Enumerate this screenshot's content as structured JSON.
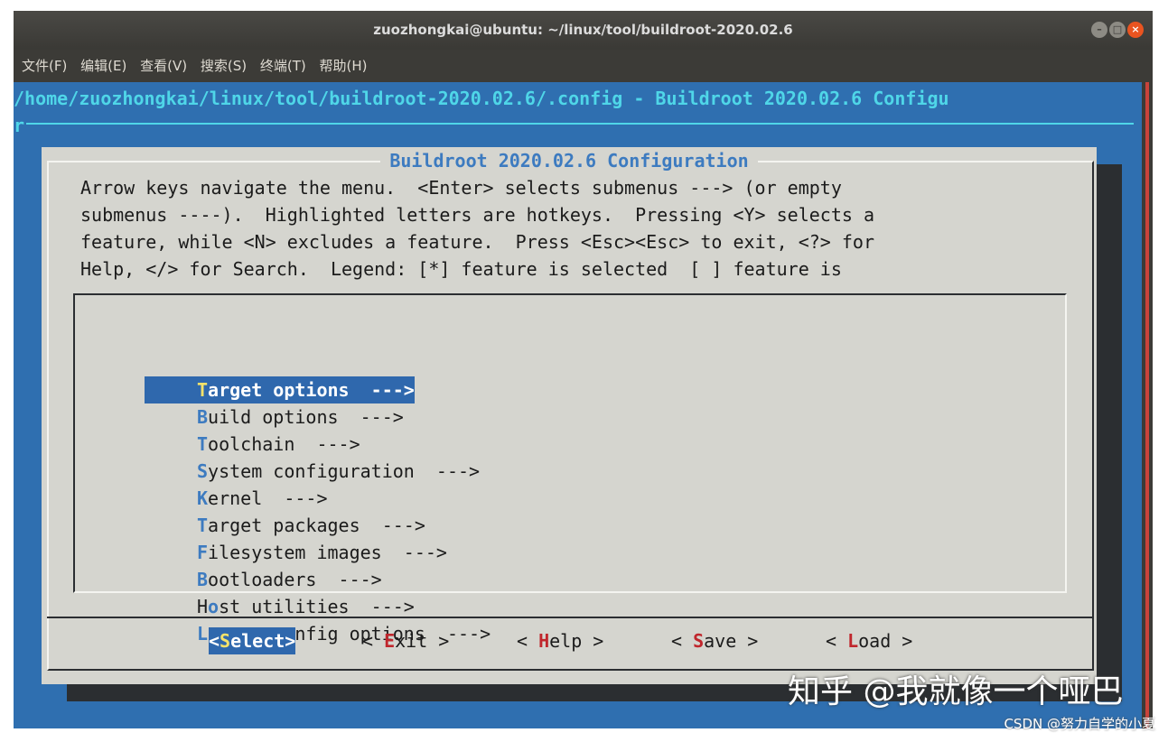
{
  "window": {
    "title": "zuozhongkai@ubuntu: ~/linux/tool/buildroot-2020.02.6",
    "controls": {
      "minimize": "–",
      "maximize": "□",
      "close": "×"
    }
  },
  "menubar": [
    "文件(F)",
    "编辑(E)",
    "查看(V)",
    "搜索(S)",
    "终端(T)",
    "帮助(H)"
  ],
  "terminal": {
    "path_line": "/home/zuozhongkai/linux/tool/buildroot-2020.02.6/.config - Buildroot 2020.02.6 Configu",
    "wrap_line": "r"
  },
  "dialog": {
    "title": "Buildroot 2020.02.6 Configuration",
    "help_lines": [
      "Arrow keys navigate the menu.  <Enter> selects submenus ---> (or empty",
      "submenus ----).  Highlighted letters are hotkeys.  Pressing <Y> selects a",
      "feature, while <N> excludes a feature.  Press <Esc><Esc> to exit, <?> for",
      "Help, </> for Search.  Legend: [*] feature is selected  [ ] feature is"
    ],
    "menu_items": [
      {
        "pre": "",
        "hot": "T",
        "rest": "arget options  --->",
        "selected": true
      },
      {
        "pre": "",
        "hot": "B",
        "rest": "uild options  --->",
        "selected": false
      },
      {
        "pre": "",
        "hot": "T",
        "rest": "oolchain  --->",
        "selected": false
      },
      {
        "pre": "",
        "hot": "S",
        "rest": "ystem configuration  --->",
        "selected": false
      },
      {
        "pre": "",
        "hot": "K",
        "rest": "ernel  --->",
        "selected": false
      },
      {
        "pre": "",
        "hot": "T",
        "rest": "arget packages  --->",
        "selected": false
      },
      {
        "pre": "",
        "hot": "F",
        "rest": "ilesystem images  --->",
        "selected": false
      },
      {
        "pre": "",
        "hot": "B",
        "rest": "ootloaders  --->",
        "selected": false
      },
      {
        "pre": "H",
        "hot": "o",
        "rest": "st utilities  --->",
        "selected": false
      },
      {
        "pre": "",
        "hot": "L",
        "rest": "egacy config options  --->",
        "selected": false
      }
    ],
    "buttons": [
      {
        "pre": "<",
        "hot": "S",
        "rest": "elect>",
        "selected": true
      },
      {
        "pre": "< ",
        "hot": "E",
        "rest": "xit >",
        "selected": false
      },
      {
        "pre": "< ",
        "hot": "H",
        "rest": "elp >",
        "selected": false
      },
      {
        "pre": "< ",
        "hot": "S",
        "rest": "ave >",
        "selected": false
      },
      {
        "pre": "< ",
        "hot": "L",
        "rest": "oad >",
        "selected": false
      }
    ]
  },
  "watermark": {
    "main": "知乎 @我就像一个哑巴",
    "sub": "CSDN @努力自学的小夏"
  }
}
